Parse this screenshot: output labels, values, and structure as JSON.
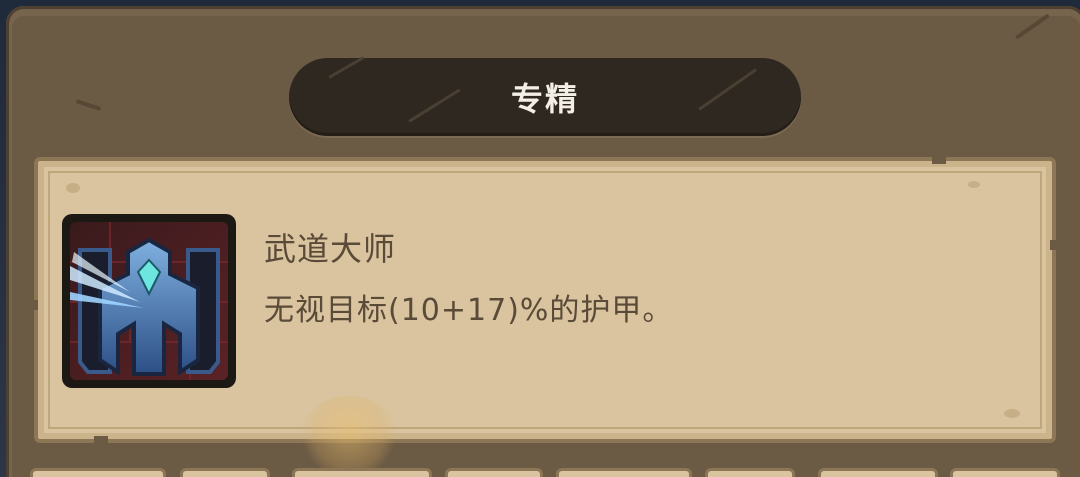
{
  "panel": {
    "title": "专精"
  },
  "skill": {
    "icon": "armor-pierce-helmet-icon",
    "name": "武道大师",
    "description": "无视目标(10+17)%的护甲。"
  },
  "colors": {
    "panel": "#6b5a44",
    "title_bar": "#2f2820",
    "card": "#d9c49f",
    "text": "#5a4a38",
    "title_text": "#f4efe6"
  }
}
